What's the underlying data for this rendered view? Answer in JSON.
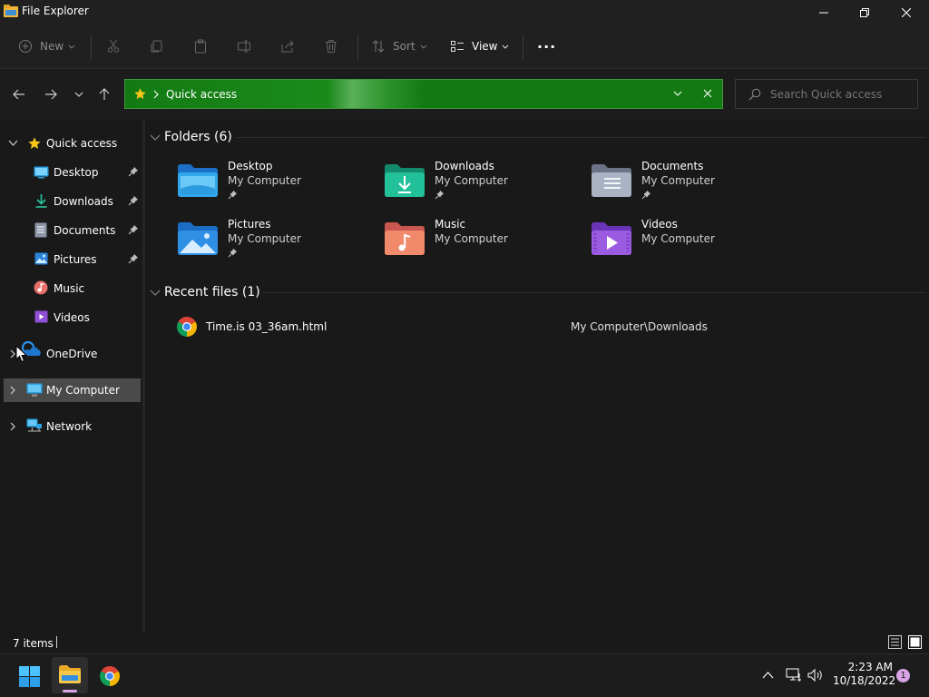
{
  "window": {
    "title": "File Explorer",
    "controls": {
      "minimize": "minimize",
      "maximize": "restore",
      "close": "close"
    }
  },
  "toolbar": {
    "new_label": "New",
    "sort_label": "Sort",
    "view_label": "View",
    "more_label": "···",
    "icons": [
      "cut-icon",
      "copy-icon",
      "paste-icon",
      "rename-icon",
      "share-icon",
      "delete-icon"
    ]
  },
  "address": {
    "path": "Quick access",
    "search_placeholder": "Search Quick access",
    "accent": "#137a13"
  },
  "sidebar": {
    "items": [
      {
        "label": "Quick access",
        "icon": "star-icon"
      },
      {
        "label": "Desktop",
        "icon": "desktop-folder-icon",
        "pinned": true
      },
      {
        "label": "Downloads",
        "icon": "downloads-icon",
        "pinned": true
      },
      {
        "label": "Documents",
        "icon": "documents-icon",
        "pinned": true
      },
      {
        "label": "Pictures",
        "icon": "pictures-icon",
        "pinned": true
      },
      {
        "label": "Music",
        "icon": "music-icon"
      },
      {
        "label": "Videos",
        "icon": "videos-icon"
      },
      {
        "label": "OneDrive",
        "icon": "onedrive-icon"
      },
      {
        "label": "My Computer",
        "icon": "computer-icon",
        "selected": true
      },
      {
        "label": "Network",
        "icon": "network-icon"
      }
    ]
  },
  "main": {
    "folders_header": "Folders (6)",
    "folders": [
      {
        "name": "Desktop",
        "location": "My Computer",
        "pinned": true
      },
      {
        "name": "Downloads",
        "location": "My Computer",
        "pinned": true
      },
      {
        "name": "Documents",
        "location": "My Computer",
        "pinned": true
      },
      {
        "name": "Pictures",
        "location": "My Computer",
        "pinned": true
      },
      {
        "name": "Music",
        "location": "My Computer"
      },
      {
        "name": "Videos",
        "location": "My Computer"
      }
    ],
    "recent_header": "Recent files (1)",
    "recent": [
      {
        "name": "Time.is 03_36am.html",
        "path": "My Computer\\Downloads",
        "icon": "chrome-icon"
      }
    ]
  },
  "status": {
    "count": "7 items"
  },
  "taskbar": {
    "time": "2:23 AM",
    "date": "10/18/2022",
    "notifications": "1"
  }
}
